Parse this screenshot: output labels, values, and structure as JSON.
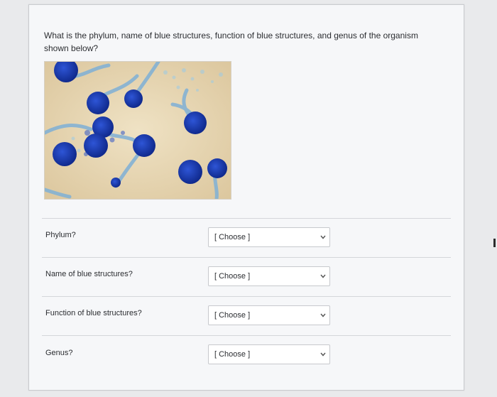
{
  "question": {
    "text": "What is the phylum, name of blue structures, function of blue structures, and genus of the organism shown below?"
  },
  "image": {
    "subject": "micrograph-blue-stained-fungus",
    "background_color": "#e8d7b5",
    "stain_color": "#1c3fb8"
  },
  "rows": [
    {
      "label": "Phylum?",
      "select": {
        "selected": "[ Choose ]"
      }
    },
    {
      "label": "Name of blue structures?",
      "select": {
        "selected": "[ Choose ]"
      }
    },
    {
      "label": "Function of blue structures?",
      "select": {
        "selected": "[ Choose ]"
      }
    },
    {
      "label": "Genus?",
      "select": {
        "selected": "[ Choose ]"
      }
    }
  ],
  "colors": {
    "panel": "#f6f7f9",
    "text": "#2b2d31",
    "border": "#c7c9cd"
  }
}
